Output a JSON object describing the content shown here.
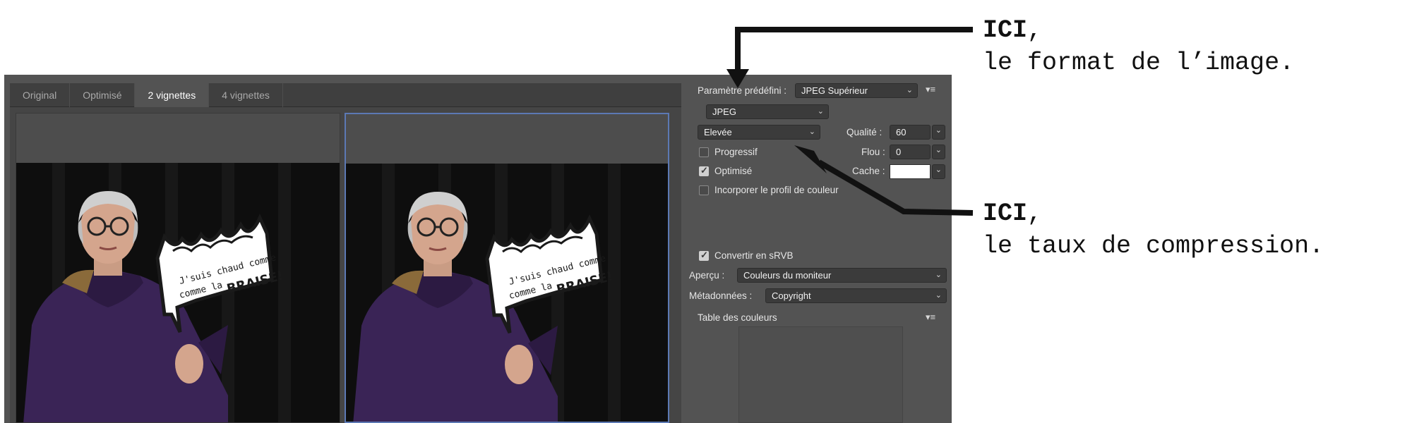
{
  "tabs": [
    {
      "label": "Original"
    },
    {
      "label": "Optimisé"
    },
    {
      "label": "2 vignettes"
    },
    {
      "label": "4 vignettes"
    }
  ],
  "active_tab": "2 vignettes",
  "preview": {
    "sign_line1": "J'suis chaud comme",
    "sign_line2": "comme la",
    "sign_big": "BRAISE!"
  },
  "settings": {
    "preset_label": "Paramètre prédéfini :",
    "preset_value": "JPEG Supérieur",
    "format_value": "JPEG",
    "compression_value": "Elevée",
    "quality_label": "Qualité :",
    "quality_value": "60",
    "progressive_label": "Progressif",
    "progressive_checked": false,
    "blur_label": "Flou :",
    "blur_value": "0",
    "optimized_label": "Optimisé",
    "optimized_checked": true,
    "matte_label": "Cache :",
    "matte_color": "#ffffff",
    "embed_profile_label": "Incorporer le profil de couleur",
    "embed_profile_checked": false,
    "convert_srgb_label": "Convertir en sRVB",
    "convert_srgb_checked": true,
    "preview_label": "Aperçu :",
    "preview_value": "Couleurs du moniteur",
    "metadata_label": "Métadonnées :",
    "metadata_value": "Copyright",
    "color_table_label": "Table des couleurs"
  },
  "annotations": {
    "top_bold": "ICI",
    "top_comma": ",",
    "top_text": "le format de l’image.",
    "bottom_bold": "ICI",
    "bottom_comma": ",",
    "bottom_text": "le taux de compression."
  },
  "colors": {
    "dialog_bg": "#535353",
    "tab_bar_bg": "#3f3f3f",
    "selected_pane_border": "#5c79b4",
    "coat": "#3a2456",
    "annotation_text": "#111111"
  }
}
